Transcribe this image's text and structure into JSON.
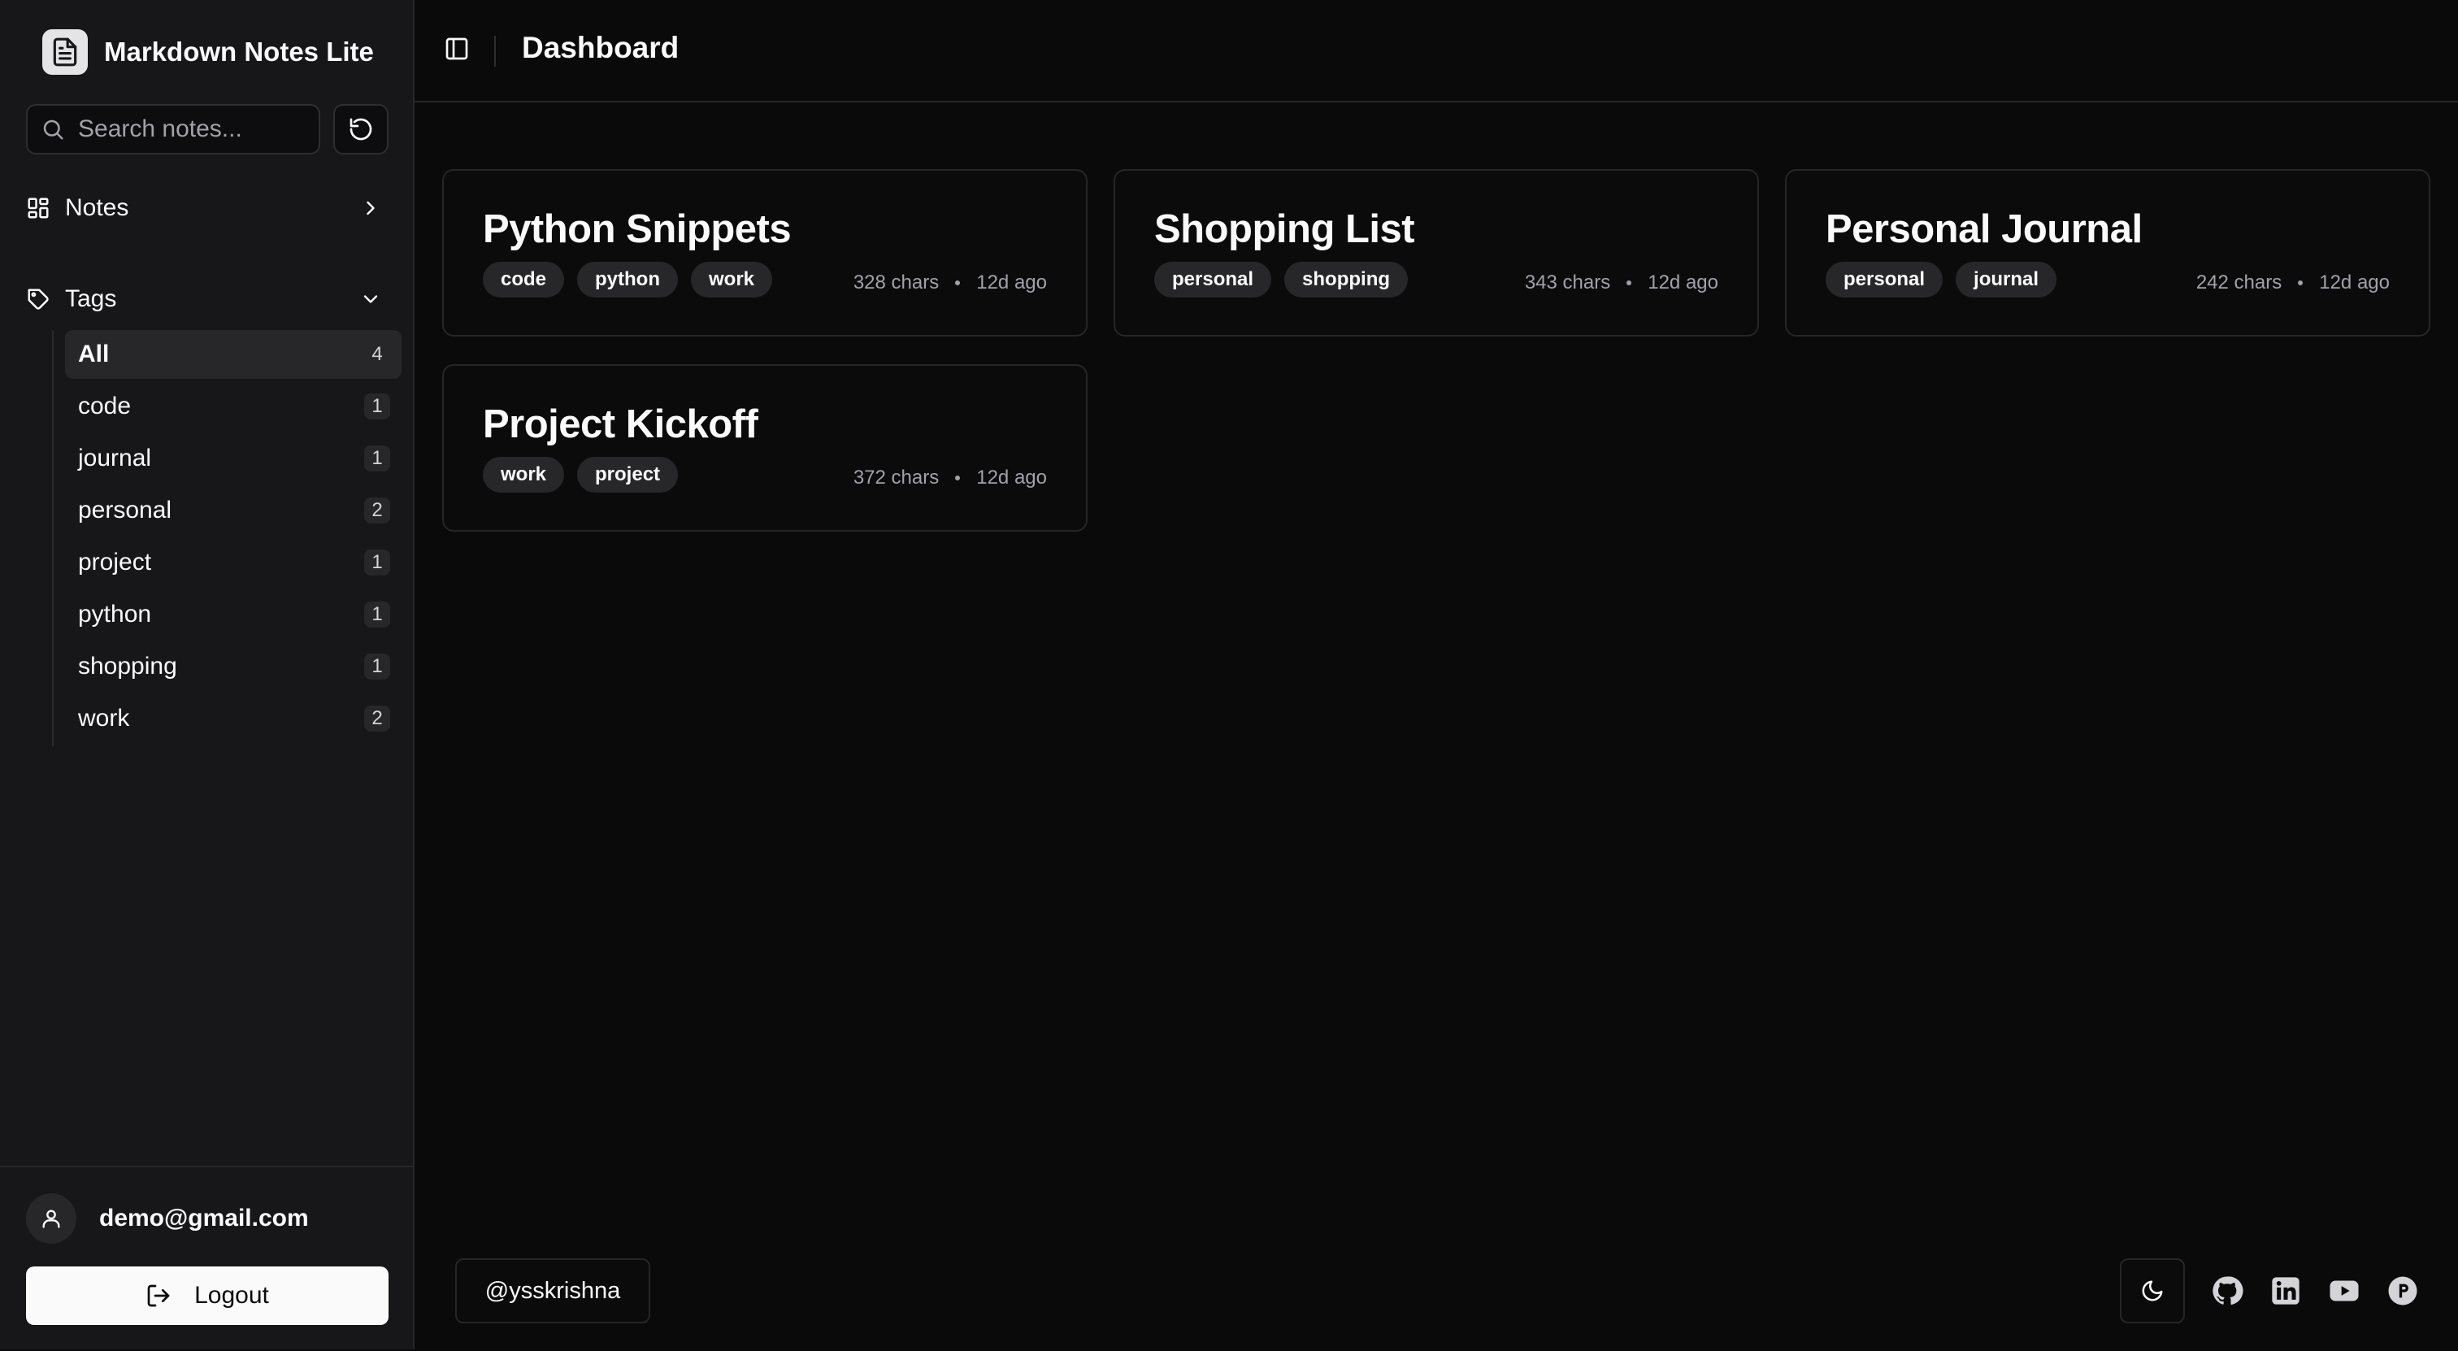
{
  "app": {
    "name": "Markdown Notes Lite",
    "logo_icon": "file-text-icon"
  },
  "search": {
    "placeholder": "Search notes...",
    "value": ""
  },
  "sidebar": {
    "notes_label": "Notes",
    "tags_label": "Tags",
    "tags": [
      {
        "name": "All",
        "count": "4",
        "active": true
      },
      {
        "name": "code",
        "count": "1"
      },
      {
        "name": "journal",
        "count": "1"
      },
      {
        "name": "personal",
        "count": "2"
      },
      {
        "name": "project",
        "count": "1"
      },
      {
        "name": "python",
        "count": "1"
      },
      {
        "name": "shopping",
        "count": "1"
      },
      {
        "name": "work",
        "count": "2"
      }
    ]
  },
  "user": {
    "email": "demo@gmail.com",
    "logout_label": "Logout"
  },
  "header": {
    "title": "Dashboard"
  },
  "notes": [
    {
      "title": "Python Snippets",
      "tags": [
        "code",
        "python",
        "work"
      ],
      "chars": "328 chars",
      "updated": "12d ago"
    },
    {
      "title": "Shopping List",
      "tags": [
        "personal",
        "shopping"
      ],
      "chars": "343 chars",
      "updated": "12d ago"
    },
    {
      "title": "Personal Journal",
      "tags": [
        "personal",
        "journal"
      ],
      "chars": "242 chars",
      "updated": "12d ago"
    },
    {
      "title": "Project Kickoff",
      "tags": [
        "work",
        "project"
      ],
      "chars": "372 chars",
      "updated": "12d ago"
    }
  ],
  "footer": {
    "handle": "@ysskrishna",
    "social_icons": [
      "github-icon",
      "linkedin-icon",
      "youtube-icon",
      "producthunt-icon"
    ]
  },
  "colors": {
    "background": "#0a0a0a",
    "sidebar": "#171719",
    "chip": "#27272a",
    "primary_button": "#fafafa"
  }
}
